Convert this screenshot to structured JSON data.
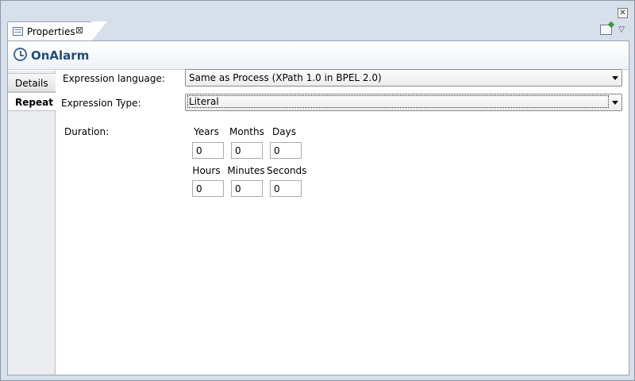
{
  "view": {
    "tab_label": "Properties",
    "tab_close_glyph": "⊠",
    "window_close_glyph": "✕",
    "menu_glyph": "▽"
  },
  "header": {
    "title": "OnAlarm",
    "icon": "clock-icon"
  },
  "sidetabs": [
    {
      "label": "Details",
      "selected": false
    },
    {
      "label": "Repeat",
      "selected": true
    }
  ],
  "form": {
    "expression_language_label": "Expression language:",
    "expression_language_value": "Same as Process (XPath 1.0 in BPEL 2.0)",
    "expression_type_label": "Expression Type:",
    "expression_type_value": "Literal",
    "duration_label": "Duration:",
    "years_label": "Years",
    "years_value": "0",
    "months_label": "Months",
    "months_value": "0",
    "days_label": "Days",
    "days_value": "0",
    "hours_label": "Hours",
    "hours_value": "0",
    "minutes_label": "Minutes",
    "minutes_value": "0",
    "seconds_label": "Seconds",
    "seconds_value": "0"
  }
}
